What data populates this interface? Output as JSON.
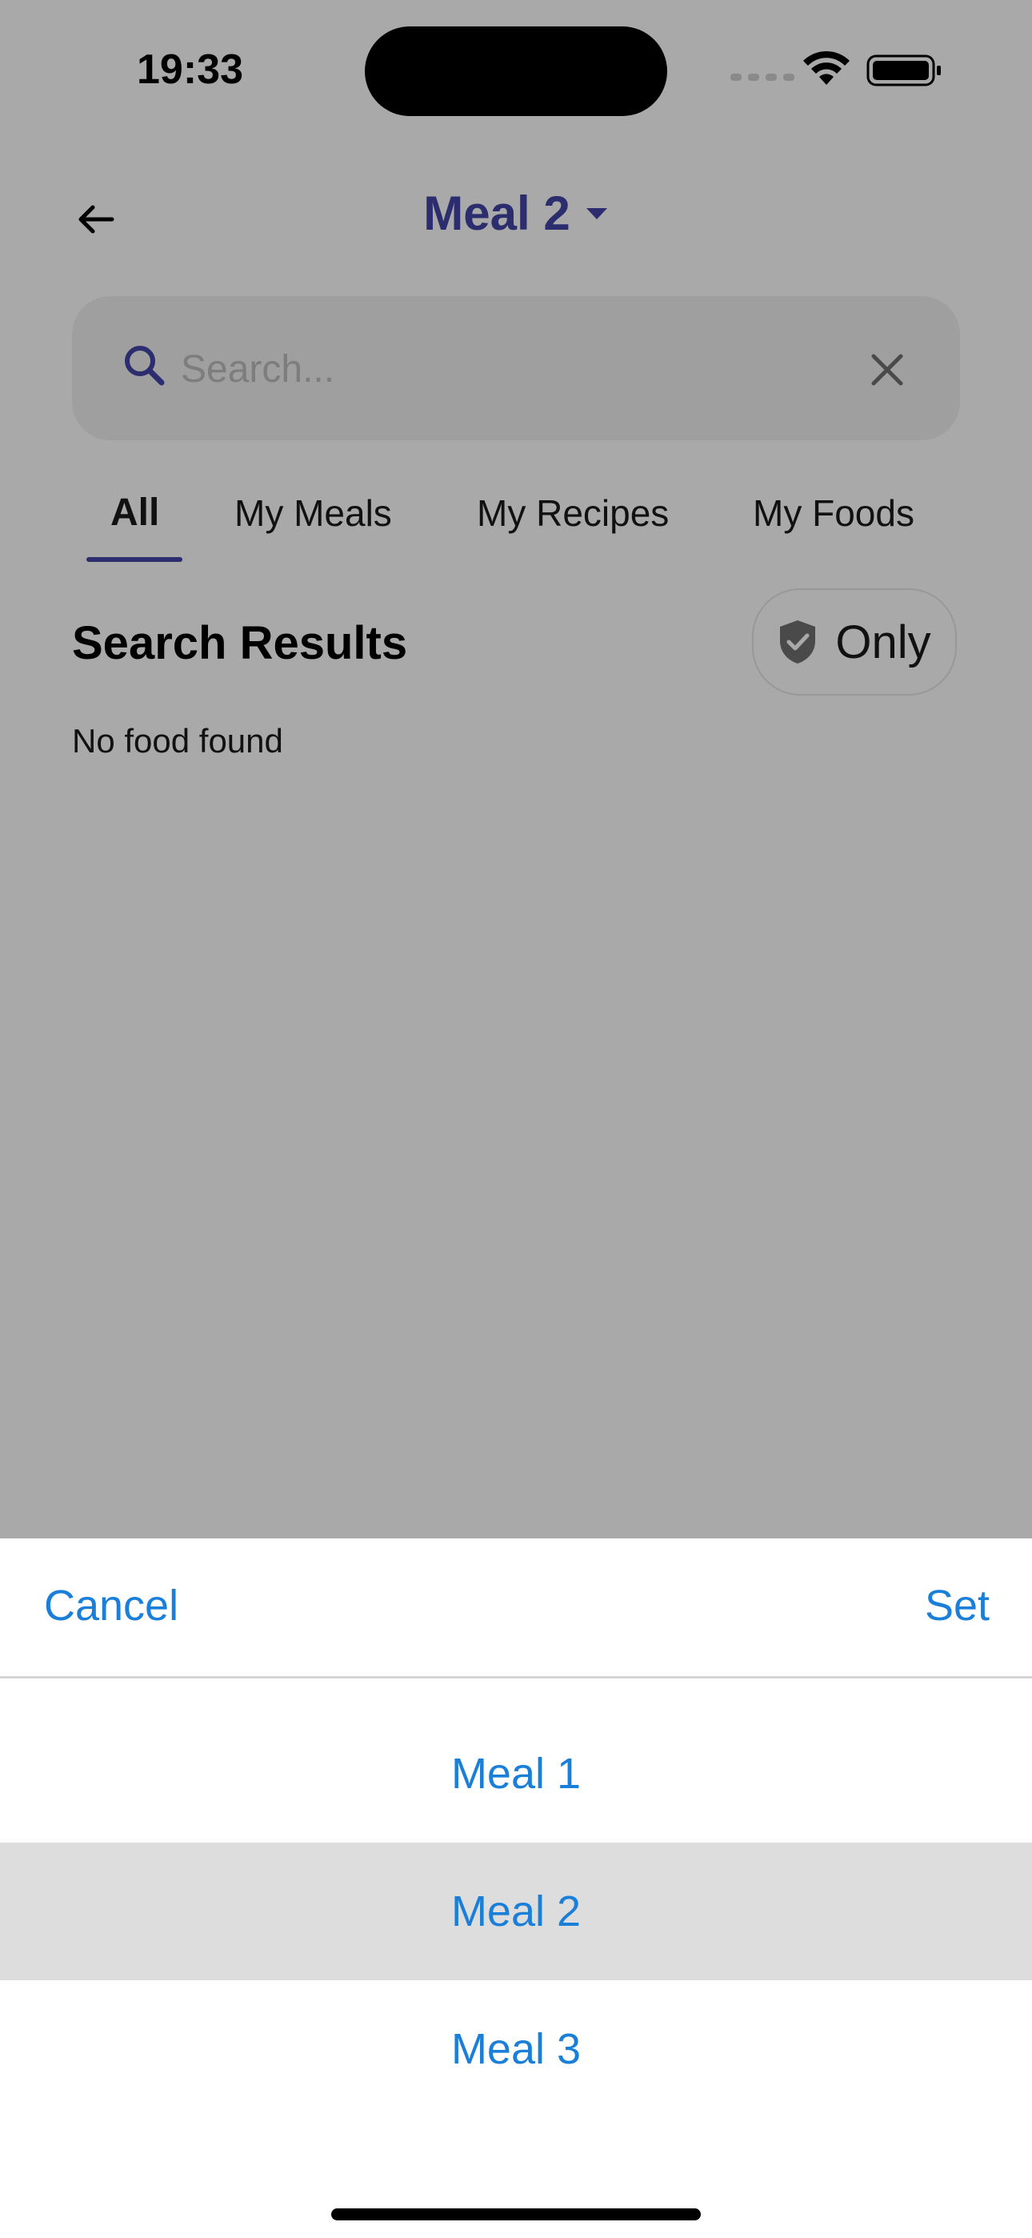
{
  "status_bar": {
    "time": "19:33"
  },
  "header": {
    "title": "Meal 2"
  },
  "search": {
    "placeholder": "Search..."
  },
  "tabs": [
    {
      "label": "All",
      "active": true
    },
    {
      "label": "My Meals",
      "active": false
    },
    {
      "label": "My Recipes",
      "active": false
    },
    {
      "label": "My Foods",
      "active": false
    }
  ],
  "results": {
    "title": "Search Results",
    "filter_label": "Only",
    "empty_text": "No food found"
  },
  "picker": {
    "cancel_label": "Cancel",
    "set_label": "Set",
    "options": [
      "Meal 1",
      "Meal 2",
      "Meal 3"
    ],
    "selected": "Meal 2"
  },
  "colors": {
    "accent_navy": "#2b2d6e",
    "link_blue": "#1a7fd9",
    "overlay": "#a9a9a9"
  }
}
